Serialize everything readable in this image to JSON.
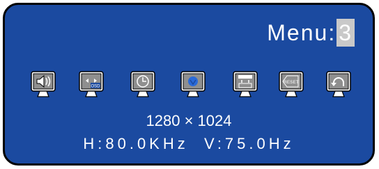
{
  "menu": {
    "label": "Menu:",
    "number": "3"
  },
  "icons": [
    {
      "name": "speaker-icon",
      "text": ""
    },
    {
      "name": "osd-position-icon",
      "text": "OSD"
    },
    {
      "name": "clock-icon",
      "text": ""
    },
    {
      "name": "color-icon",
      "text": ""
    },
    {
      "name": "settings-panel-icon",
      "text": ""
    },
    {
      "name": "reset-icon",
      "text": "RESET"
    },
    {
      "name": "return-icon",
      "text": ""
    }
  ],
  "status": {
    "resolution": "1280 × 1024",
    "frequency": "H:80.0KHz  V:75.0Hz"
  }
}
